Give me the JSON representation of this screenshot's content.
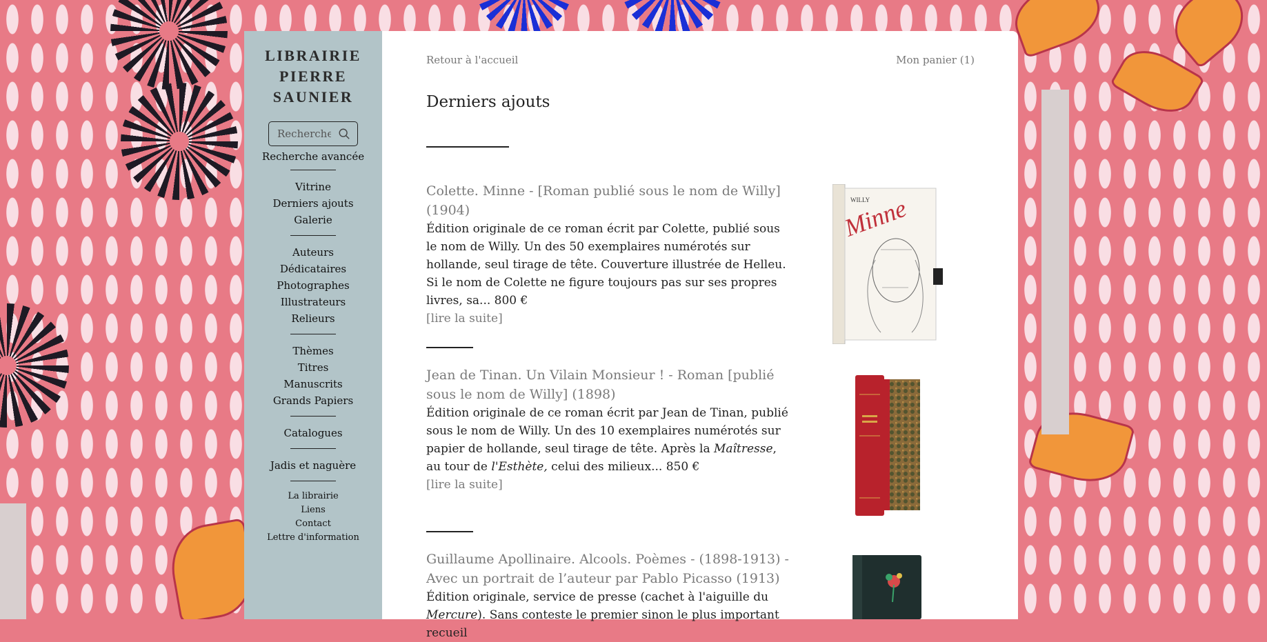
{
  "sidebar": {
    "logo": "LIBRAIRIE\nPIERRE\nSAUNIER",
    "search_placeholder": "Recherche",
    "advanced_search": "Recherche avancée",
    "group1": [
      "Vitrine",
      "Derniers ajouts",
      "Galerie"
    ],
    "group2": [
      "Auteurs",
      "Dédicataires",
      "Photographes",
      "Illustrateurs",
      "Relieurs"
    ],
    "group3": [
      "Thèmes",
      "Titres",
      "Manuscrits",
      "Grands Papiers"
    ],
    "group4": [
      "Catalogues"
    ],
    "group5": [
      "Jadis et naguère"
    ],
    "group6": [
      "La librairie",
      "Liens",
      "Contact",
      "Lettre d'information"
    ]
  },
  "main": {
    "back_link": "Retour à l'accueil",
    "cart_link": "Mon panier (1)",
    "title": "Derniers ajouts",
    "entries": [
      {
        "title": "Colette. Minne - [Roman publié sous le nom de Willy] (1904)",
        "description": "Édition originale de ce roman écrit par Colette, publié sous le nom de Willy. Un des 50 exemplaires numérotés sur hollande, seul tirage de tête. Couverture illustrée de Helleu. Si le nom de Colette ne figure toujours pas sur ses propres livres, sa... 800 €",
        "more": "[lire la suite]",
        "cover_author": "WILLY",
        "cover_title": "Minne"
      },
      {
        "title": "Jean de Tinan. Un Vilain Monsieur ! - Roman [publié sous le nom de Willy] (1898)",
        "description_parts": [
          "Édition originale de ce roman écrit par Jean de Tinan, publié sous le nom de Willy. Un des 10 exemplaires numérotés sur papier de hollande, seul tirage de tête. Après la ",
          "Maîtresse",
          ", au tour de ",
          "l'Esthète,",
          " celui des milieux... 850 €"
        ],
        "more": "[lire la suite]"
      },
      {
        "title": "Guillaume Apollinaire. Alcools. Poèmes - (1898-1913) - Avec un portrait de l’auteur par Pablo Picasso (1913)",
        "description_parts": [
          "Édition originale, service de presse (cachet à l'aiguille du ",
          "Mercure",
          "). Sans conteste le premier sinon le plus important recueil"
        ]
      }
    ]
  },
  "colors": {
    "wallpaper": "#e87a86",
    "sidebar": "#b2c4c8",
    "link_grey": "#7a7a7a",
    "accent_blue": "#1a2fd6",
    "accent_orange": "#f1963a"
  }
}
